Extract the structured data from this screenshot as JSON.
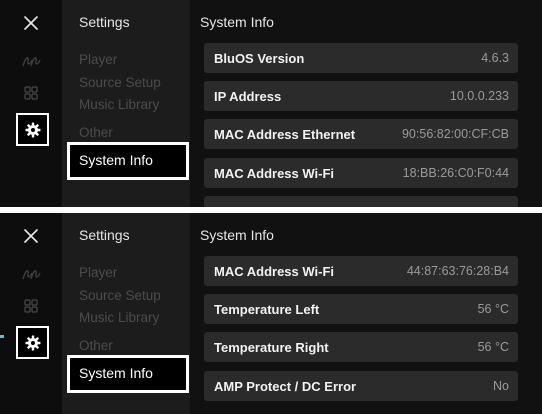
{
  "screens": [
    {
      "nav": {
        "title": "Settings",
        "items": [
          "Player",
          "Source Setup",
          "Music Library",
          "Other"
        ],
        "selected": "System Info"
      },
      "main": {
        "title": "System Info",
        "rows": [
          {
            "label": "BluOS Version",
            "value": "4.6.3"
          },
          {
            "label": "IP Address",
            "value": "10.0.0.233"
          },
          {
            "label": "MAC Address Ethernet",
            "value": "90:56:82:00:CF:CB"
          },
          {
            "label": "MAC Address Wi-Fi",
            "value": "18:BB:26:C0:F0:44"
          }
        ]
      }
    },
    {
      "nav": {
        "title": "Settings",
        "items": [
          "Player",
          "Source Setup",
          "Music Library",
          "Other"
        ],
        "selected": "System Info"
      },
      "main": {
        "title": "System Info",
        "rows": [
          {
            "label": "MAC Address Wi-Fi",
            "value": "44:87:63:76:28:B4"
          },
          {
            "label": "Temperature Left",
            "value": "56 °C"
          },
          {
            "label": "Temperature Right",
            "value": "56 °C"
          },
          {
            "label": "AMP Protect / DC Error",
            "value": "No"
          }
        ]
      }
    }
  ],
  "icons": {
    "close": "close-icon",
    "brand": "bluos-logo-icon",
    "grid": "grid-icon",
    "settings": "gear-icon"
  },
  "colors": {
    "background": "#141414",
    "row": "#2b2b2b",
    "highlight_border": "#ffffff",
    "label": "#f2f2f2",
    "value": "#9a9a9a",
    "dim_nav": "#4c4c4c"
  }
}
